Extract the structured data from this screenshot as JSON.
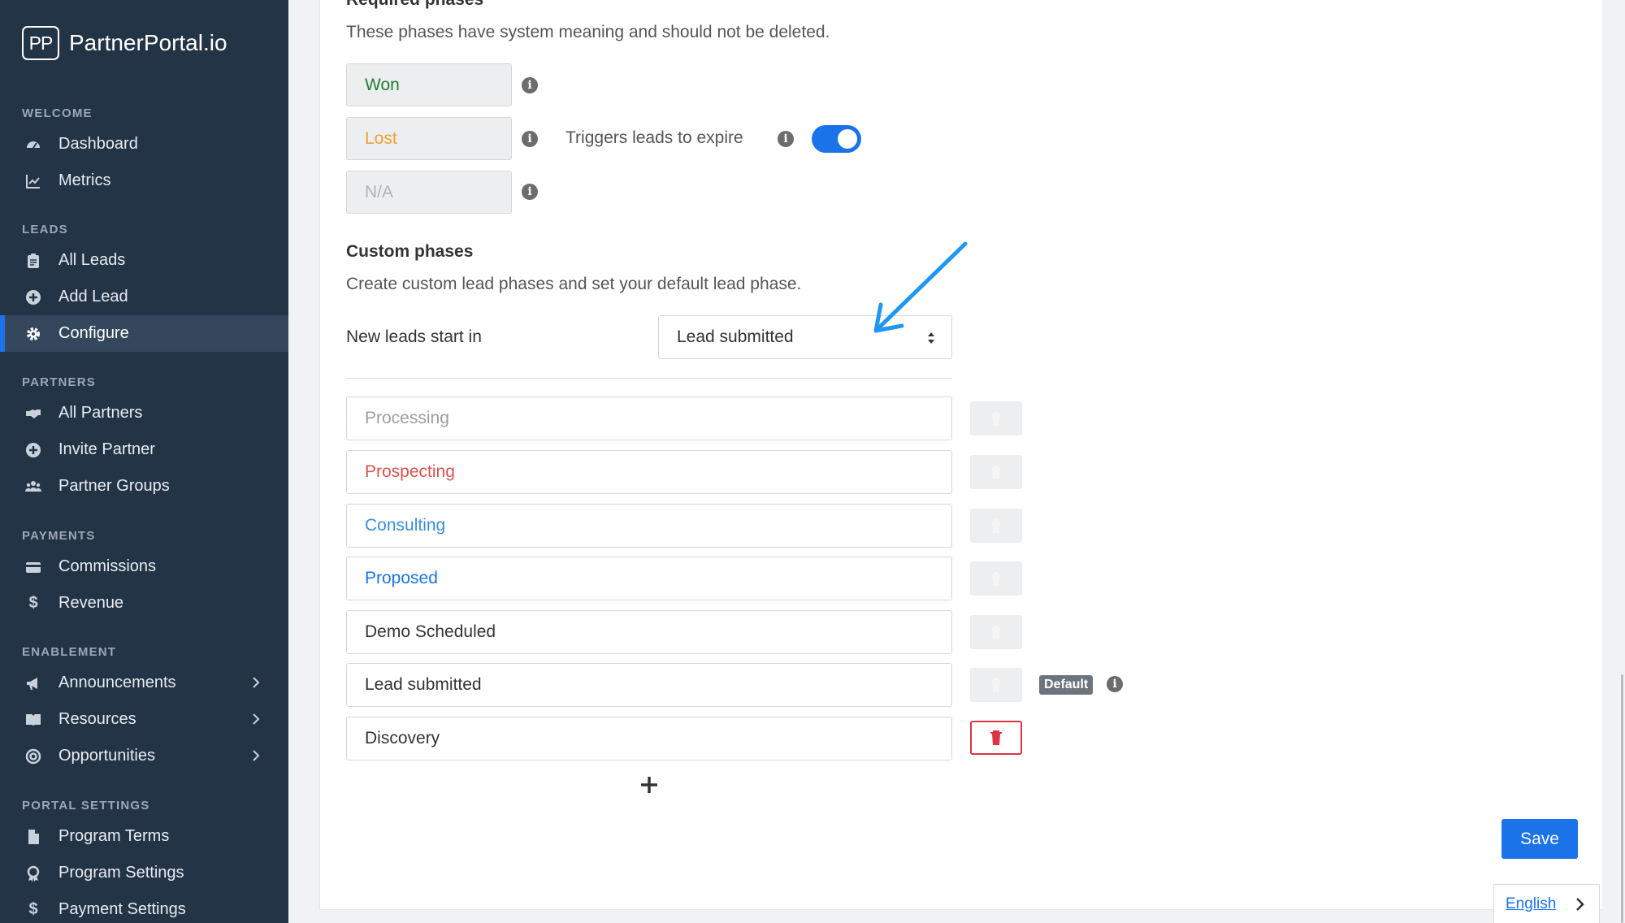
{
  "brand": {
    "logo": "PP",
    "name": "PartnerPortal.io"
  },
  "sidebar": {
    "sections": [
      {
        "title": "WELCOME",
        "items": [
          {
            "label": "Dashboard",
            "icon": "gauge-icon"
          },
          {
            "label": "Metrics",
            "icon": "line-chart-icon"
          }
        ]
      },
      {
        "title": "LEADS",
        "items": [
          {
            "label": "All Leads",
            "icon": "clipboard-icon"
          },
          {
            "label": "Add Lead",
            "icon": "plus-circle-icon"
          },
          {
            "label": "Configure",
            "icon": "gear-icon",
            "active": true
          }
        ]
      },
      {
        "title": "PARTNERS",
        "items": [
          {
            "label": "All Partners",
            "icon": "handshake-icon"
          },
          {
            "label": "Invite Partner",
            "icon": "plus-circle-icon"
          },
          {
            "label": "Partner Groups",
            "icon": "users-icon"
          }
        ]
      },
      {
        "title": "PAYMENTS",
        "items": [
          {
            "label": "Commissions",
            "icon": "credit-card-icon"
          },
          {
            "label": "Revenue",
            "icon": "dollar-icon"
          }
        ]
      },
      {
        "title": "ENABLEMENT",
        "items": [
          {
            "label": "Announcements",
            "icon": "megaphone-icon"
          },
          {
            "label": "Resources",
            "icon": "book-icon"
          },
          {
            "label": "Opportunities",
            "icon": "target-icon"
          }
        ]
      },
      {
        "title": "PORTAL SETTINGS",
        "items": [
          {
            "label": "Program Terms",
            "icon": "file-icon"
          },
          {
            "label": "Program Settings",
            "icon": "award-icon"
          },
          {
            "label": "Payment Settings",
            "icon": "dollar-icon"
          }
        ]
      }
    ]
  },
  "required": {
    "title": "Required phases",
    "description": "These phases have system meaning and should not be deleted.",
    "phases": [
      {
        "label": "Won",
        "color": "#1e7e34"
      },
      {
        "label": "Lost",
        "color": "#f0a030"
      },
      {
        "label": "N/A",
        "color": "#b0b4b9"
      }
    ],
    "expire_label": "Triggers leads to expire",
    "expire_enabled": true
  },
  "custom": {
    "title": "Custom phases",
    "description": "Create custom lead phases and set your default lead phase.",
    "start_label": "New leads start in",
    "start_value": "Lead submitted",
    "phases": [
      {
        "label": "Processing",
        "color": "#9a9ea3"
      },
      {
        "label": "Prospecting",
        "color": "#d9534f"
      },
      {
        "label": "Consulting",
        "color": "#3a8fd6"
      },
      {
        "label": "Proposed",
        "color": "#1a73e8"
      },
      {
        "label": "Demo Scheduled",
        "color": "#333333"
      },
      {
        "label": "Lead submitted",
        "color": "#333333",
        "default": true
      },
      {
        "label": "Discovery",
        "color": "#333333",
        "deletable": true
      }
    ],
    "default_badge": "Default"
  },
  "actions": {
    "save_label": "Save"
  },
  "language": {
    "label": "English"
  },
  "colors": {
    "accent": "#1a73e8",
    "sidebar_bg": "#243447",
    "danger": "#dc3545"
  }
}
